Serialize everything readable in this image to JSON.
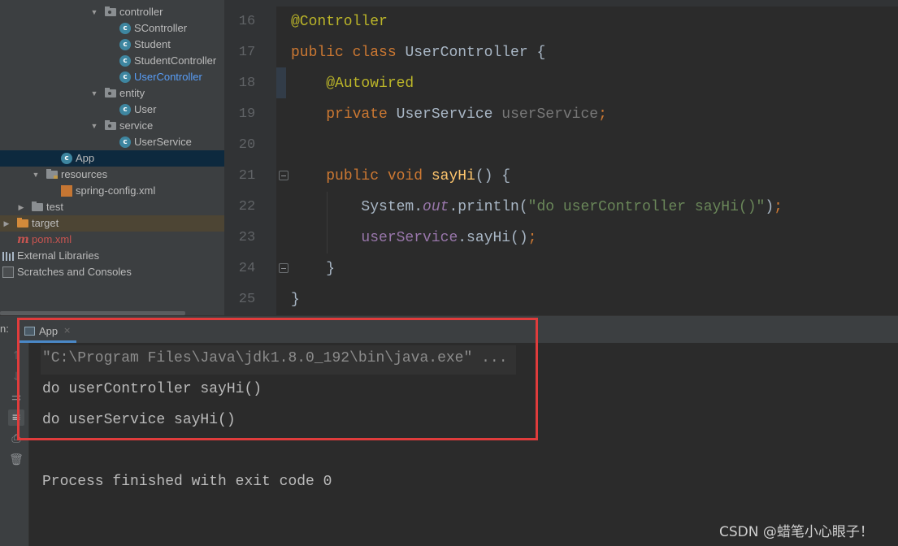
{
  "project_tree": {
    "items": [
      {
        "label": "controller",
        "kind": "package"
      },
      {
        "label": "SController",
        "kind": "class"
      },
      {
        "label": "Student",
        "kind": "class"
      },
      {
        "label": "StudentController",
        "kind": "class"
      },
      {
        "label": "UserController",
        "kind": "class"
      },
      {
        "label": "entity",
        "kind": "package"
      },
      {
        "label": "User",
        "kind": "class"
      },
      {
        "label": "service",
        "kind": "package"
      },
      {
        "label": "UserService",
        "kind": "class"
      },
      {
        "label": "App",
        "kind": "class",
        "selected": true
      },
      {
        "label": "resources",
        "kind": "resources-folder"
      },
      {
        "label": "spring-config.xml",
        "kind": "xml-file"
      },
      {
        "label": "test",
        "kind": "folder"
      },
      {
        "label": "target",
        "kind": "target-folder"
      },
      {
        "label": "pom.xml",
        "kind": "maven-file"
      },
      {
        "label": "External Libraries",
        "kind": "libraries"
      },
      {
        "label": "Scratches and Consoles",
        "kind": "scratches"
      }
    ]
  },
  "editor": {
    "line_numbers": [
      "16",
      "17",
      "18",
      "19",
      "20",
      "21",
      "22",
      "23",
      "24",
      "25"
    ],
    "lines": [
      [
        {
          "t": "@Controller",
          "c": "ann"
        }
      ],
      [
        {
          "t": "public class ",
          "c": "kw"
        },
        {
          "t": "UserController {",
          "c": ""
        }
      ],
      [
        {
          "t": "    ",
          "c": ""
        },
        {
          "t": "@Autowired",
          "c": "ann"
        }
      ],
      [
        {
          "t": "    ",
          "c": ""
        },
        {
          "t": "private ",
          "c": "kw"
        },
        {
          "t": "UserService ",
          "c": ""
        },
        {
          "t": "userService",
          "c": "gray"
        },
        {
          "t": ";",
          "c": "kw"
        }
      ],
      [
        {
          "t": "",
          "c": ""
        }
      ],
      [
        {
          "t": "    ",
          "c": ""
        },
        {
          "t": "public void ",
          "c": "kw"
        },
        {
          "t": "sayHi",
          "c": "fn"
        },
        {
          "t": "() {",
          "c": ""
        }
      ],
      [
        {
          "t": "        System.",
          "c": ""
        },
        {
          "t": "out",
          "c": "st"
        },
        {
          "t": ".println(",
          "c": ""
        },
        {
          "t": "\"do userController sayHi()\"",
          "c": "str"
        },
        {
          "t": ")",
          "c": ""
        },
        {
          "t": ";",
          "c": "kw"
        }
      ],
      [
        {
          "t": "        ",
          "c": ""
        },
        {
          "t": "userService",
          "c": "fld"
        },
        {
          "t": ".sayHi()",
          "c": ""
        },
        {
          "t": ";",
          "c": "kw"
        }
      ],
      [
        {
          "t": "    }",
          "c": ""
        }
      ],
      [
        {
          "t": "}",
          "c": ""
        }
      ]
    ]
  },
  "run_panel": {
    "label": "n:",
    "tab_label": "App",
    "tab_close": "×",
    "console_lines": [
      "\"C:\\Program Files\\Java\\jdk1.8.0_192\\bin\\java.exe\" ...",
      "do userController sayHi()",
      "do userService sayHi()",
      "",
      "Process finished with exit code 0"
    ]
  },
  "watermark": "CSDN @蜡笔小心眼子！",
  "colors": {
    "highlight_box": "#e03c3c",
    "keyword": "#cc7832",
    "annotation": "#bbb529",
    "string": "#6a8759",
    "selected_row": "#0d293e"
  }
}
